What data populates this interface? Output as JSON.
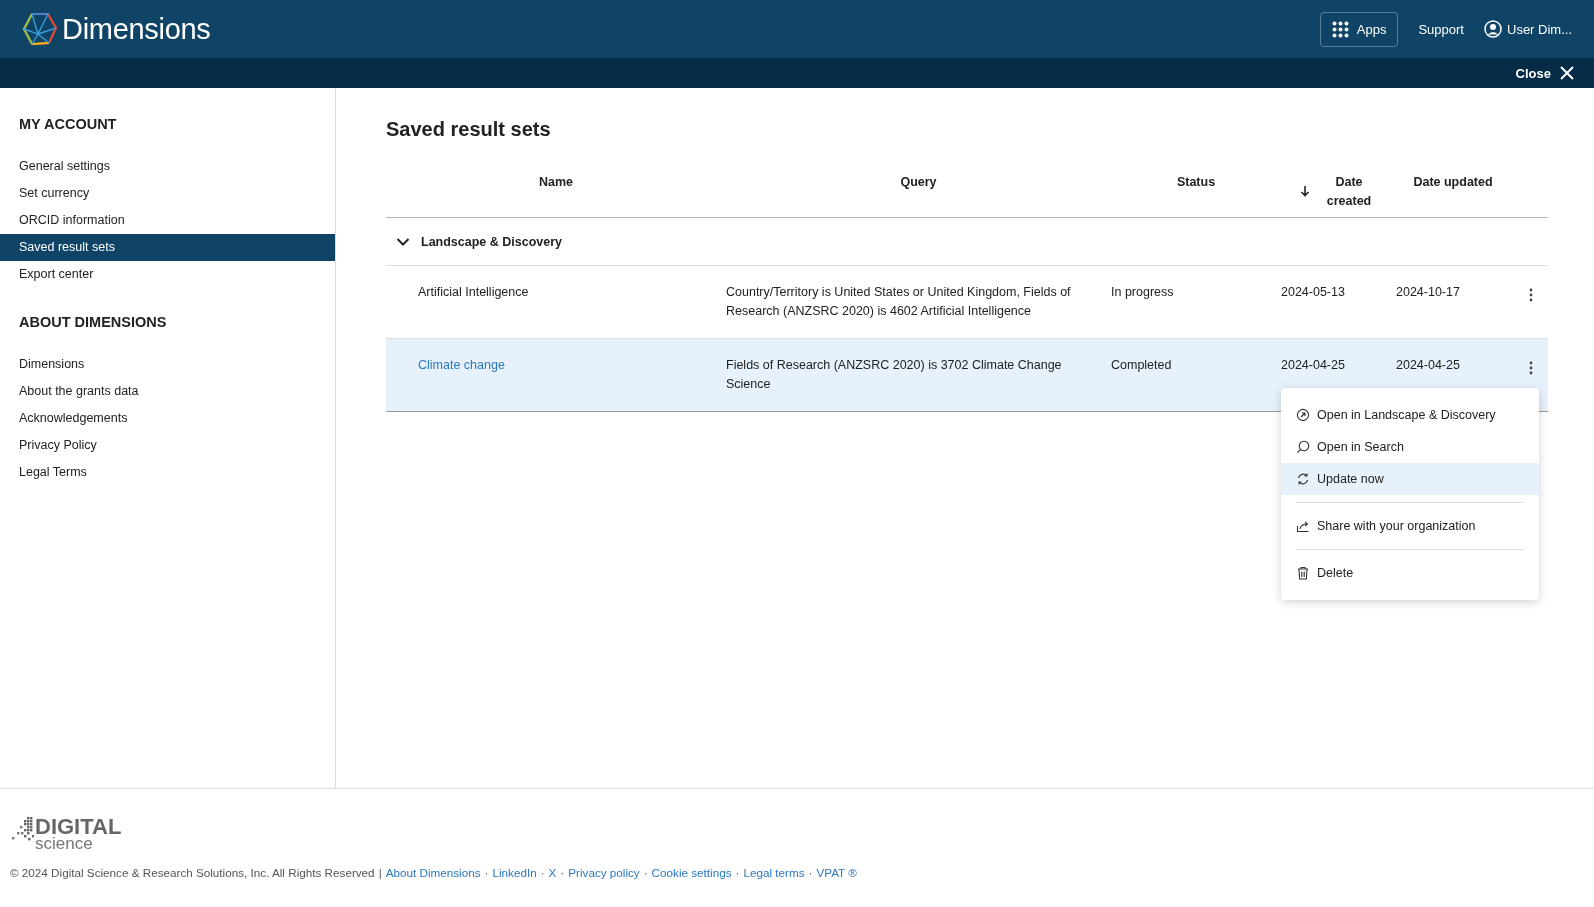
{
  "header": {
    "brand": "Dimensions",
    "apps": "Apps",
    "support": "Support",
    "user": "User Dim..."
  },
  "subbar": {
    "close": "Close"
  },
  "sidebar": {
    "sections": [
      {
        "title": "MY ACCOUNT",
        "items": [
          {
            "label": "General settings",
            "selected": false
          },
          {
            "label": "Set currency",
            "selected": false
          },
          {
            "label": "ORCID information",
            "selected": false
          },
          {
            "label": "Saved result sets",
            "selected": true
          },
          {
            "label": "Export center",
            "selected": false
          }
        ]
      },
      {
        "title": "ABOUT DIMENSIONS",
        "items": [
          {
            "label": "Dimensions",
            "selected": false
          },
          {
            "label": "About the grants data",
            "selected": false
          },
          {
            "label": "Acknowledgements",
            "selected": false
          },
          {
            "label": "Privacy Policy",
            "selected": false
          },
          {
            "label": "Legal Terms",
            "selected": false
          }
        ]
      }
    ]
  },
  "main": {
    "title": "Saved result sets",
    "table": {
      "columns": [
        {
          "label": "Name",
          "sorted": false
        },
        {
          "label": "Query",
          "sorted": false
        },
        {
          "label": "Status",
          "sorted": false
        },
        {
          "label": "Date created",
          "sorted": true
        },
        {
          "label": "Date updated",
          "sorted": false
        }
      ],
      "groups": [
        {
          "label": "Landscape & Discovery",
          "expanded": true,
          "rows": [
            {
              "name": "Artificial Intelligence",
              "query": "Country/Territory is United States or United Kingdom, Fields of Research (ANZSRC 2020) is 4602 Artificial Intelligence",
              "status": "In progress",
              "created": "2024-05-13",
              "updated": "2024-10-17",
              "selected": false
            },
            {
              "name": "Climate change",
              "query": "Fields of Research (ANZSRC 2020) is 3702 Climate Change Science",
              "status": "Completed",
              "created": "2024-04-25",
              "updated": "2024-04-25",
              "selected": true
            }
          ]
        }
      ]
    },
    "menu": [
      {
        "kind": "item",
        "label": "Open in Landscape & Discovery",
        "selected": false
      },
      {
        "kind": "item",
        "label": "Open in Search",
        "selected": false
      },
      {
        "kind": "item",
        "label": "Update now",
        "selected": true
      },
      {
        "kind": "divider"
      },
      {
        "kind": "item",
        "label": "Share with your organization",
        "selected": false
      },
      {
        "kind": "divider"
      },
      {
        "kind": "item",
        "label": "Delete",
        "selected": false
      }
    ]
  },
  "footer": {
    "logo_top": "DIGITAL",
    "logo_bottom": "science",
    "items": [
      {
        "kind": "text",
        "text": "© 2024 Digital Science & Research Solutions, Inc. All Rights Reserved"
      },
      {
        "kind": "sep",
        "text": "|"
      },
      {
        "kind": "link",
        "text": "About Dimensions"
      },
      {
        "kind": "sep",
        "text": "·"
      },
      {
        "kind": "link",
        "text": "LinkedIn"
      },
      {
        "kind": "sep",
        "text": "·"
      },
      {
        "kind": "link",
        "text": "X"
      },
      {
        "kind": "sep",
        "text": "·"
      },
      {
        "kind": "link",
        "text": "Privacy policy"
      },
      {
        "kind": "sep",
        "text": "·"
      },
      {
        "kind": "link",
        "text": "Cookie settings"
      },
      {
        "kind": "sep",
        "text": "·"
      },
      {
        "kind": "link",
        "text": "Legal terms"
      },
      {
        "kind": "sep",
        "text": "·"
      },
      {
        "kind": "link",
        "text": "VPAT ®"
      }
    ]
  }
}
